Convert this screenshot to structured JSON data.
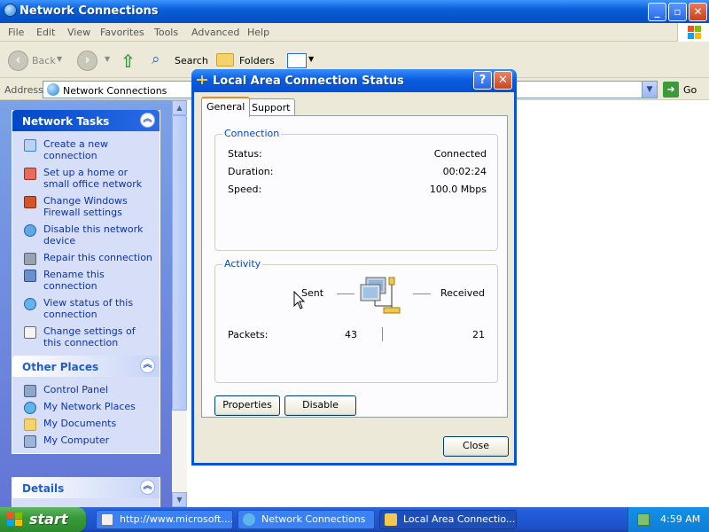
{
  "explorer": {
    "title": "Network Connections",
    "menu": [
      "File",
      "Edit",
      "View",
      "Favorites",
      "Tools",
      "Advanced",
      "Help"
    ],
    "toolbar": {
      "back": "Back",
      "search": "Search",
      "folders": "Folders"
    },
    "address": {
      "label": "Address",
      "value": "Network Connections",
      "go": "Go"
    }
  },
  "network_tasks": {
    "title": "Network Tasks",
    "items": [
      "Create a new connection",
      "Set up a home or small office network",
      "Change Windows Firewall settings",
      "Disable this network device",
      "Repair this connection",
      "Rename this connection",
      "View status of this connection",
      "Change settings of this connection"
    ]
  },
  "other_places": {
    "title": "Other Places",
    "items": [
      "Control Panel",
      "My Network Places",
      "My Documents",
      "My Computer"
    ]
  },
  "details": {
    "title": "Details"
  },
  "dialog": {
    "title": "Local Area Connection Status",
    "tabs": [
      "General",
      "Support"
    ],
    "connection": {
      "legend": "Connection",
      "status_label": "Status:",
      "status_value": "Connected",
      "duration_label": "Duration:",
      "duration_value": "00:02:24",
      "speed_label": "Speed:",
      "speed_value": "100.0 Mbps"
    },
    "activity": {
      "legend": "Activity",
      "sent": "Sent",
      "received": "Received",
      "packets_label": "Packets:",
      "packets_sent": "43",
      "packets_received": "21"
    },
    "buttons": {
      "properties": "Properties",
      "disable": "Disable",
      "close": "Close"
    },
    "help": "?"
  },
  "taskbar": {
    "start": "start",
    "items": [
      "http://www.microsoft....",
      "Network Connections",
      "Local Area Connectio..."
    ],
    "clock": "4:59 AM"
  },
  "colors": {
    "xp_blue": "#0a5fd8",
    "link": "#0c32a9",
    "group_legend": "#0046d5",
    "start_green": "#3a9a3a"
  }
}
